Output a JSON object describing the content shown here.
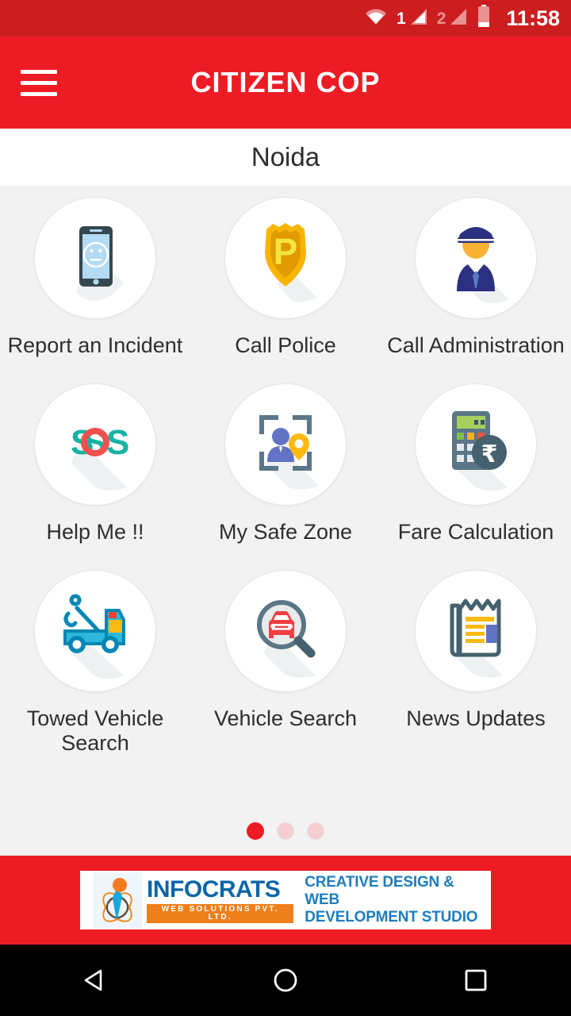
{
  "status_bar": {
    "wifi_icon": "wifi-icon",
    "sim1_label": "1",
    "sim1_icon": "signal-bars-icon",
    "sim2_label": "2",
    "sim2_icon": "signal-bars-icon",
    "battery_icon": "battery-icon",
    "time": "11:58",
    "background_color": "#cc1d1f"
  },
  "app_bar": {
    "menu_icon": "hamburger-menu-icon",
    "title": "CITIZEN COP",
    "background_color": "#ed1c24"
  },
  "location": {
    "name": "Noida"
  },
  "grid": {
    "tiles": [
      {
        "label": "Report an Incident",
        "icon": "phone-sad-face-icon"
      },
      {
        "label": "Call Police",
        "icon": "police-badge-icon"
      },
      {
        "label": "Call Administration",
        "icon": "police-officer-icon"
      },
      {
        "label": "Help Me !!",
        "icon": "sos-icon"
      },
      {
        "label": "My Safe Zone",
        "icon": "person-location-frame-icon"
      },
      {
        "label": "Fare Calculation",
        "icon": "calculator-rupee-icon"
      },
      {
        "label": "Towed Vehicle Search",
        "icon": "tow-truck-icon"
      },
      {
        "label": "Vehicle Search",
        "icon": "car-magnifier-icon"
      },
      {
        "label": "News Updates",
        "icon": "newspaper-icon"
      }
    ]
  },
  "pager": {
    "total": 3,
    "active_index": 0,
    "active_color": "#ed1c24",
    "inactive_color": "#f6cdd0"
  },
  "ad": {
    "logo_icon": "infocrats-atom-logo-icon",
    "brand_name": "INFOCRATS",
    "brand_sub": "WEB SOLUTIONS PVT. LTD.",
    "tagline_line1": "CREATIVE DESIGN & WEB",
    "tagline_line2": "DEVELOPMENT STUDIO",
    "brand_color": "#0a66a8",
    "accent_color": "#ef7f1a"
  },
  "nav_bar": {
    "back_icon": "back-triangle-icon",
    "home_icon": "home-circle-icon",
    "recents_icon": "recents-square-icon"
  }
}
